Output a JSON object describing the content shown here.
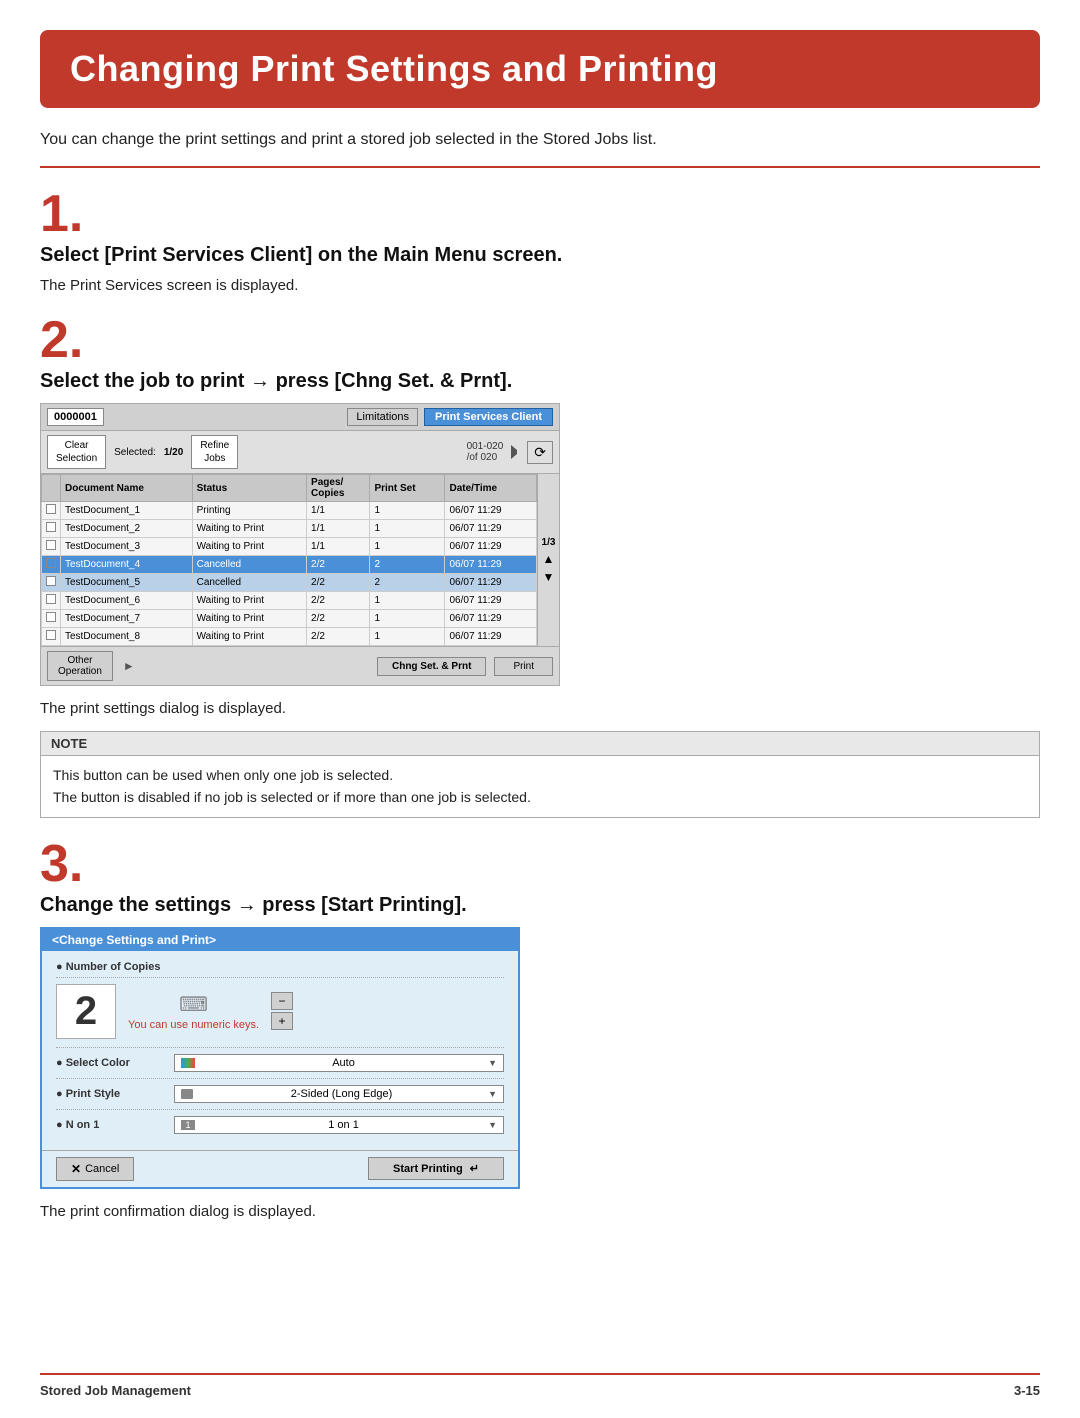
{
  "header": {
    "title": "Changing Print Settings and Printing",
    "background_color": "#c0392b"
  },
  "intro": {
    "text": "You can change the print settings and print a stored job selected in the Stored Jobs list."
  },
  "steps": [
    {
      "number": "1.",
      "heading": "Select [Print Services Client] on the Main Menu screen.",
      "body": "The Print Services screen is displayed."
    },
    {
      "number": "2.",
      "heading": "Select the job to print → press [Chng Set. & Prnt].",
      "body": "The print settings dialog is displayed."
    },
    {
      "number": "3.",
      "heading": "Change the settings → press [Start Printing].",
      "body": "The print confirmation dialog is displayed."
    }
  ],
  "psc_screen": {
    "id": "0000001",
    "limitations_btn": "Limitations",
    "title_btn": "Print Services Client",
    "clear_selection_btn": "Clear\nSelection",
    "selected_label": "Selected:",
    "selected_value": "1/20",
    "refine_jobs_btn": "Refine\nJobs",
    "page_info": "001-020\n/of 020",
    "columns": [
      "Document Name",
      "Status",
      "Pages/Copies",
      "Print Set",
      "Date/Time"
    ],
    "rows": [
      {
        "checkbox": false,
        "name": "TestDocument_1",
        "status": "Printing",
        "pages": "1/1",
        "print_set": "1",
        "date": "06/07 11:29",
        "highlighted": false,
        "sub": false
      },
      {
        "checkbox": false,
        "name": "TestDocument_2",
        "status": "Waiting to Print",
        "pages": "1/1",
        "print_set": "1",
        "date": "06/07 11:29",
        "highlighted": false,
        "sub": false
      },
      {
        "checkbox": false,
        "name": "TestDocument_3",
        "status": "Waiting to Print",
        "pages": "1/1",
        "print_set": "1",
        "date": "06/07 11:29",
        "highlighted": false,
        "sub": false
      },
      {
        "checkbox": true,
        "name": "TestDocument_4",
        "status": "Cancelled",
        "pages": "2/2",
        "print_set": "2",
        "date": "06/07 11:29",
        "highlighted": true,
        "sub": false
      },
      {
        "checkbox": false,
        "name": "TestDocument_5",
        "status": "Cancelled",
        "pages": "2/2",
        "print_set": "2",
        "date": "06/07 11:29",
        "highlighted": false,
        "sub": true
      },
      {
        "checkbox": false,
        "name": "TestDocument_6",
        "status": "Waiting to Print",
        "pages": "2/2",
        "print_set": "1",
        "date": "06/07 11:29",
        "highlighted": false,
        "sub": false
      },
      {
        "checkbox": false,
        "name": "TestDocument_7",
        "status": "Waiting to Print",
        "pages": "2/2",
        "print_set": "1",
        "date": "06/07 11:29",
        "highlighted": false,
        "sub": false
      },
      {
        "checkbox": false,
        "name": "TestDocument_8",
        "status": "Waiting to Print",
        "pages": "2/2",
        "print_set": "1",
        "date": "06/07 11:29",
        "highlighted": false,
        "sub": false
      }
    ],
    "pagination": "1/3",
    "other_operation_btn": "Other\nOperation",
    "chng_set_btn": "Chng Set. & Prnt",
    "print_btn": "Print"
  },
  "note": {
    "label": "NOTE",
    "lines": [
      "This button can be used when only one job is selected.",
      "The button is disabled if no job is selected or if more than one job is selected."
    ]
  },
  "dialog": {
    "title": "<Change Settings and Print>",
    "number_of_copies_label": "● Number of Copies",
    "copies_value": "2",
    "copies_hint": "You can use numeric keys.",
    "minus_label": "−",
    "plus_label": "+",
    "select_color_label": "● Select Color",
    "select_color_value": "Auto",
    "print_style_label": "● Print Style",
    "print_style_value": "2-Sided (Long Edge)",
    "n_on_1_label": "● N on 1",
    "n_on_1_value": "1 on 1",
    "cancel_btn": "Cancel",
    "start_printing_btn": "Start Printing"
  },
  "footer": {
    "label": "Stored Job Management",
    "page": "3-15"
  }
}
